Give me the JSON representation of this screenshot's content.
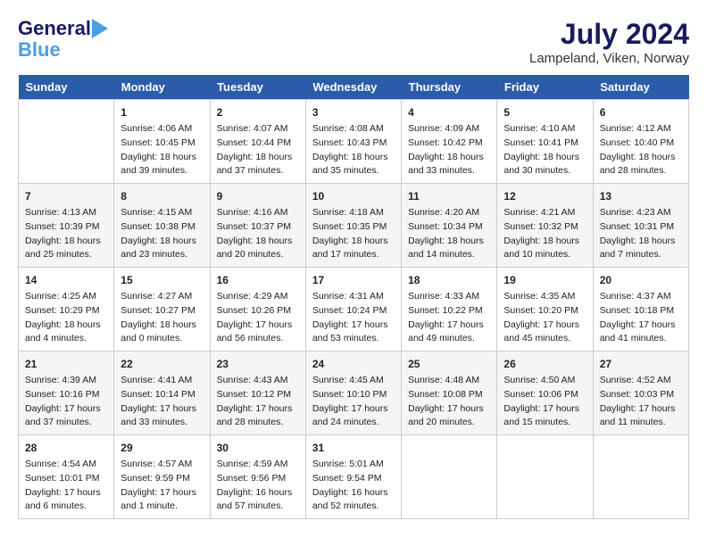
{
  "header": {
    "logo_line1": "General",
    "logo_line2": "Blue",
    "month_year": "July 2024",
    "location": "Lampeland, Viken, Norway"
  },
  "weekdays": [
    "Sunday",
    "Monday",
    "Tuesday",
    "Wednesday",
    "Thursday",
    "Friday",
    "Saturday"
  ],
  "weeks": [
    [
      {
        "day": "",
        "info": ""
      },
      {
        "day": "1",
        "info": "Sunrise: 4:06 AM\nSunset: 10:45 PM\nDaylight: 18 hours\nand 39 minutes."
      },
      {
        "day": "2",
        "info": "Sunrise: 4:07 AM\nSunset: 10:44 PM\nDaylight: 18 hours\nand 37 minutes."
      },
      {
        "day": "3",
        "info": "Sunrise: 4:08 AM\nSunset: 10:43 PM\nDaylight: 18 hours\nand 35 minutes."
      },
      {
        "day": "4",
        "info": "Sunrise: 4:09 AM\nSunset: 10:42 PM\nDaylight: 18 hours\nand 33 minutes."
      },
      {
        "day": "5",
        "info": "Sunrise: 4:10 AM\nSunset: 10:41 PM\nDaylight: 18 hours\nand 30 minutes."
      },
      {
        "day": "6",
        "info": "Sunrise: 4:12 AM\nSunset: 10:40 PM\nDaylight: 18 hours\nand 28 minutes."
      }
    ],
    [
      {
        "day": "7",
        "info": "Sunrise: 4:13 AM\nSunset: 10:39 PM\nDaylight: 18 hours\nand 25 minutes."
      },
      {
        "day": "8",
        "info": "Sunrise: 4:15 AM\nSunset: 10:38 PM\nDaylight: 18 hours\nand 23 minutes."
      },
      {
        "day": "9",
        "info": "Sunrise: 4:16 AM\nSunset: 10:37 PM\nDaylight: 18 hours\nand 20 minutes."
      },
      {
        "day": "10",
        "info": "Sunrise: 4:18 AM\nSunset: 10:35 PM\nDaylight: 18 hours\nand 17 minutes."
      },
      {
        "day": "11",
        "info": "Sunrise: 4:20 AM\nSunset: 10:34 PM\nDaylight: 18 hours\nand 14 minutes."
      },
      {
        "day": "12",
        "info": "Sunrise: 4:21 AM\nSunset: 10:32 PM\nDaylight: 18 hours\nand 10 minutes."
      },
      {
        "day": "13",
        "info": "Sunrise: 4:23 AM\nSunset: 10:31 PM\nDaylight: 18 hours\nand 7 minutes."
      }
    ],
    [
      {
        "day": "14",
        "info": "Sunrise: 4:25 AM\nSunset: 10:29 PM\nDaylight: 18 hours\nand 4 minutes."
      },
      {
        "day": "15",
        "info": "Sunrise: 4:27 AM\nSunset: 10:27 PM\nDaylight: 18 hours\nand 0 minutes."
      },
      {
        "day": "16",
        "info": "Sunrise: 4:29 AM\nSunset: 10:26 PM\nDaylight: 17 hours\nand 56 minutes."
      },
      {
        "day": "17",
        "info": "Sunrise: 4:31 AM\nSunset: 10:24 PM\nDaylight: 17 hours\nand 53 minutes."
      },
      {
        "day": "18",
        "info": "Sunrise: 4:33 AM\nSunset: 10:22 PM\nDaylight: 17 hours\nand 49 minutes."
      },
      {
        "day": "19",
        "info": "Sunrise: 4:35 AM\nSunset: 10:20 PM\nDaylight: 17 hours\nand 45 minutes."
      },
      {
        "day": "20",
        "info": "Sunrise: 4:37 AM\nSunset: 10:18 PM\nDaylight: 17 hours\nand 41 minutes."
      }
    ],
    [
      {
        "day": "21",
        "info": "Sunrise: 4:39 AM\nSunset: 10:16 PM\nDaylight: 17 hours\nand 37 minutes."
      },
      {
        "day": "22",
        "info": "Sunrise: 4:41 AM\nSunset: 10:14 PM\nDaylight: 17 hours\nand 33 minutes."
      },
      {
        "day": "23",
        "info": "Sunrise: 4:43 AM\nSunset: 10:12 PM\nDaylight: 17 hours\nand 28 minutes."
      },
      {
        "day": "24",
        "info": "Sunrise: 4:45 AM\nSunset: 10:10 PM\nDaylight: 17 hours\nand 24 minutes."
      },
      {
        "day": "25",
        "info": "Sunrise: 4:48 AM\nSunset: 10:08 PM\nDaylight: 17 hours\nand 20 minutes."
      },
      {
        "day": "26",
        "info": "Sunrise: 4:50 AM\nSunset: 10:06 PM\nDaylight: 17 hours\nand 15 minutes."
      },
      {
        "day": "27",
        "info": "Sunrise: 4:52 AM\nSunset: 10:03 PM\nDaylight: 17 hours\nand 11 minutes."
      }
    ],
    [
      {
        "day": "28",
        "info": "Sunrise: 4:54 AM\nSunset: 10:01 PM\nDaylight: 17 hours\nand 6 minutes."
      },
      {
        "day": "29",
        "info": "Sunrise: 4:57 AM\nSunset: 9:59 PM\nDaylight: 17 hours\nand 1 minute."
      },
      {
        "day": "30",
        "info": "Sunrise: 4:59 AM\nSunset: 9:56 PM\nDaylight: 16 hours\nand 57 minutes."
      },
      {
        "day": "31",
        "info": "Sunrise: 5:01 AM\nSunset: 9:54 PM\nDaylight: 16 hours\nand 52 minutes."
      },
      {
        "day": "",
        "info": ""
      },
      {
        "day": "",
        "info": ""
      },
      {
        "day": "",
        "info": ""
      }
    ]
  ]
}
